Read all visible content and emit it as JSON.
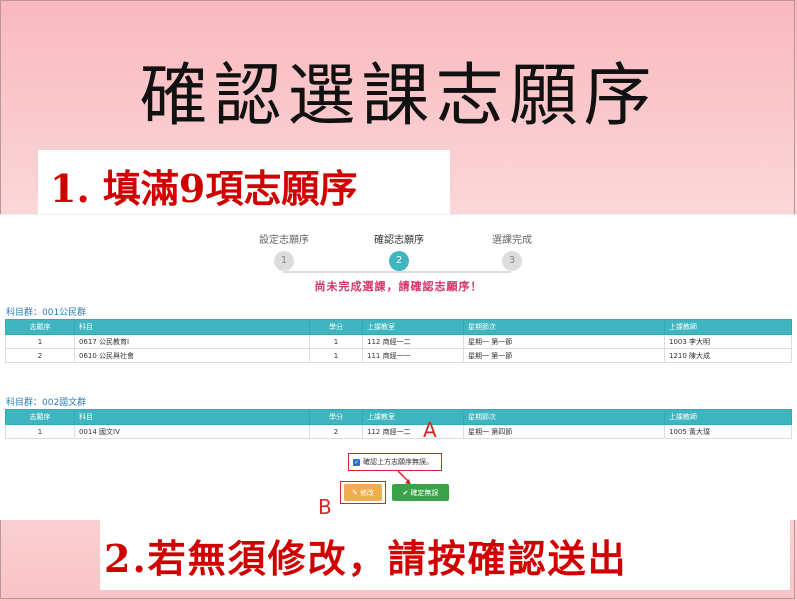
{
  "slide_title": "確認選課志願序",
  "callout_top": "1. 填滿9項志願序",
  "callout_bottom": "2.若無須修改，請按確認送出",
  "steps": [
    {
      "label": "設定志願序",
      "number": "1"
    },
    {
      "label": "確認志願序",
      "number": "2"
    },
    {
      "label": "選課完成",
      "number": "3"
    }
  ],
  "warning": "尚未完成選課，請確認志願序！",
  "columns": [
    "志願序",
    "科目",
    "學分",
    "上課教室",
    "星期節次",
    "上課教師"
  ],
  "group1": {
    "title": "科目群：001公民群",
    "rows": [
      [
        "1",
        "0617 公民教育Ⅰ",
        "1",
        "112 商經一二",
        "星期一 第一節",
        "1003 李大明"
      ],
      [
        "2",
        "0610 公民與社會",
        "1",
        "111 商經一一",
        "星期一 第一節",
        "1210 陳大成"
      ]
    ]
  },
  "group2": {
    "title": "科目群：002國文群",
    "rows": [
      [
        "1",
        "0014 國文IV",
        "2",
        "112 商經一二",
        "星期一 第四節",
        "1005 黃大璞"
      ]
    ]
  },
  "confirm_checkbox_label": "確認上方志願序無誤。",
  "annotation_a": "A",
  "annotation_b": "B",
  "edit_button_label": "修改",
  "ok_button_label": "確定無誤",
  "colors": {
    "accent": "#3fb5bf",
    "warning": "#d6336c",
    "edit": "#f0ad4e",
    "ok": "#3aa34a",
    "callout": "#d10000"
  }
}
